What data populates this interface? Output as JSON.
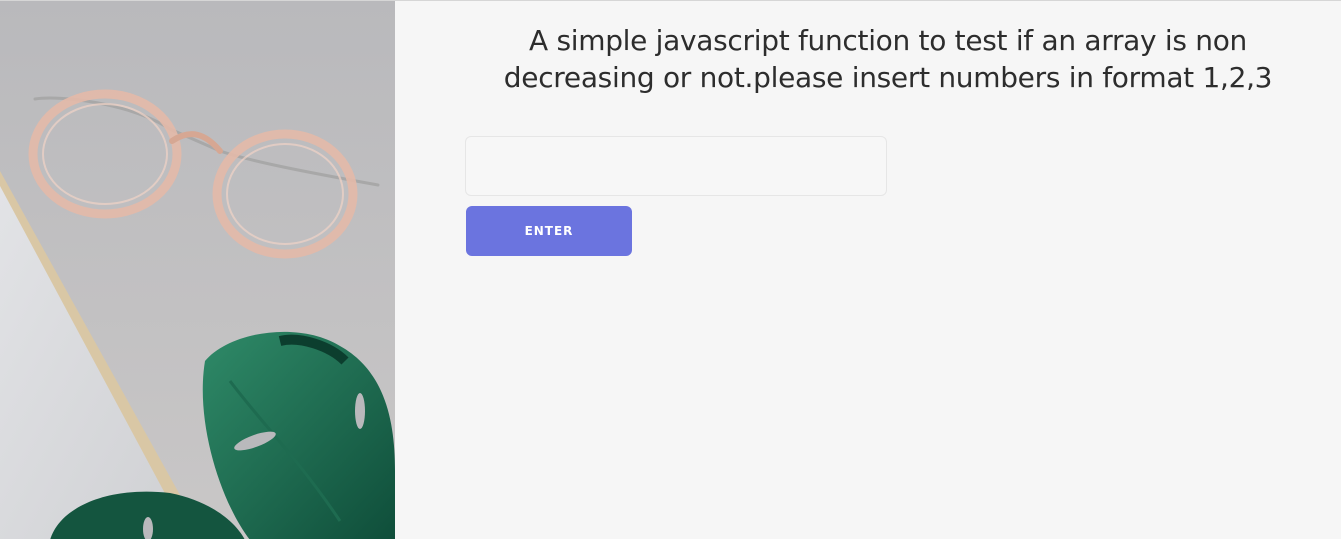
{
  "heading": {
    "text": "A simple javascript function to test if an array is non decreasing or not.please insert numbers in format 1,2,3"
  },
  "form": {
    "input_value": "",
    "input_placeholder": "",
    "button_label": "ENTER"
  },
  "decor": {
    "image": "photo of pink-rimmed eyeglasses and green monstera leaves on a grey surface"
  },
  "colors": {
    "accent": "#6b74df",
    "background": "#f6f6f6",
    "text": "#2d2d2d"
  }
}
